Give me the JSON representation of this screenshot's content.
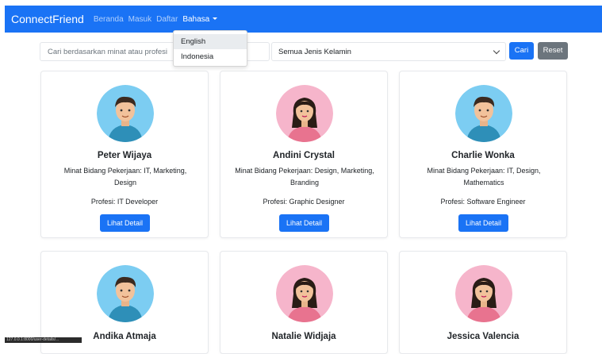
{
  "navbar": {
    "brand": "ConnectFriend",
    "links": [
      "Beranda",
      "Masuk",
      "Daftar"
    ],
    "language": "Bahasa",
    "language_options": [
      "English",
      "Indonesia"
    ]
  },
  "search": {
    "placeholder": "Cari berdasarkan minat atau profesi",
    "gender_selected": "Semua Jenis Kelamin",
    "search_button": "Cari",
    "reset_button": "Reset"
  },
  "cards": [
    {
      "name": "Peter Wijaya",
      "interest": "Minat Bidang Pekerjaan: IT, Marketing, Design",
      "profession": "Profesi: IT Developer",
      "button": "Lihat Detail",
      "avatar": "male"
    },
    {
      "name": "Andini Crystal",
      "interest": "Minat Bidang Pekerjaan: Design, Marketing, Branding",
      "profession": "Profesi: Graphic Designer",
      "button": "Lihat Detail",
      "avatar": "female"
    },
    {
      "name": "Charlie Wonka",
      "interest": "Minat Bidang Pekerjaan: IT, Design, Mathematics",
      "profession": "Profesi: Software Engineer",
      "button": "Lihat Detail",
      "avatar": "male"
    },
    {
      "name": "Andika Atmaja",
      "avatar": "male"
    },
    {
      "name": "Natalie Widjaja",
      "avatar": "female"
    },
    {
      "name": "Jessica Valencia",
      "avatar": "female"
    }
  ],
  "status_bar": "127.0.0.1:8000/user-details/...",
  "colors": {
    "primary": "#1a73f5",
    "secondary": "#6c757d",
    "male_bg": "#7ccdf2",
    "female_bg": "#f6b5cb"
  }
}
